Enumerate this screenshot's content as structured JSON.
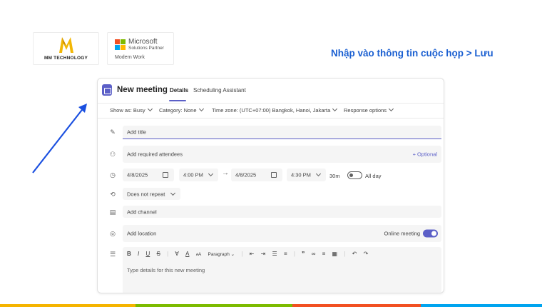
{
  "logos": {
    "mm_text": "MM TECHNOLOGY",
    "ms_name": "Microsoft",
    "ms_sub": "Solutions Partner",
    "ms_work": "Modern Work"
  },
  "instruction": "Nhập vào thông tin cuộc họp > Lưu",
  "dialog": {
    "title": "New meeting",
    "tabs": [
      {
        "label": "Details",
        "active": true
      },
      {
        "label": "Scheduling Assistant",
        "active": false
      }
    ],
    "options": {
      "show_as": "Show as: Busy",
      "category": "Category: None",
      "timezone": "Time zone: (UTC+07:00) Bangkok, Hanoi, Jakarta",
      "response": "Response options"
    },
    "title_placeholder": "Add title",
    "attendees_placeholder": "Add required attendees",
    "optional_label": "+ Optional",
    "start_date": "4/8/2025",
    "start_time": "4:00 PM",
    "end_date": "4/8/2025",
    "end_time": "4:30 PM",
    "duration": "30m",
    "all_day_label": "All day",
    "repeat": "Does not repeat",
    "channel_placeholder": "Add channel",
    "location_placeholder": "Add location",
    "online_meeting_label": "Online meeting",
    "online_meeting_on": true,
    "editor": {
      "paragraph_label": "Paragraph",
      "placeholder": "Type details for this new meeting"
    }
  },
  "colors": {
    "accent": "#5b5fc7",
    "instruction": "#1a5fd1",
    "stripes": [
      "#f5b400",
      "#7cbb00",
      "#f25022",
      "#00a4ef"
    ]
  }
}
